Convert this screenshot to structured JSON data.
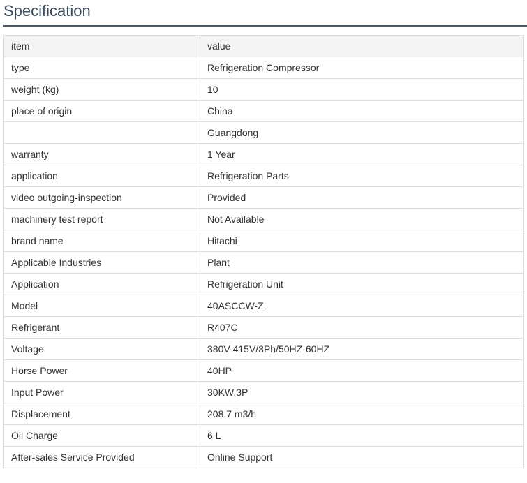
{
  "title": "Specification",
  "table": {
    "header": {
      "item": "item",
      "value": "value"
    },
    "rows": [
      {
        "item": "type",
        "value": "Refrigeration Compressor"
      },
      {
        "item": "weight (kg)",
        "value": "10"
      },
      {
        "item": "place of origin",
        "value": "China"
      },
      {
        "item": "",
        "value": "Guangdong"
      },
      {
        "item": "warranty",
        "value": "1 Year"
      },
      {
        "item": "application",
        "value": "Refrigeration Parts"
      },
      {
        "item": "video outgoing-inspection",
        "value": "Provided"
      },
      {
        "item": "machinery test report",
        "value": "Not Available"
      },
      {
        "item": "brand name",
        "value": "Hitachi"
      },
      {
        "item": "Applicable Industries",
        "value": "Plant"
      },
      {
        "item": "Application",
        "value": "Refrigeration Unit"
      },
      {
        "item": "Model",
        "value": "40ASCCW-Z"
      },
      {
        "item": "Refrigerant",
        "value": "R407C"
      },
      {
        "item": "Voltage",
        "value": "380V-415V/3Ph/50HZ-60HZ"
      },
      {
        "item": "Horse Power",
        "value": "40HP"
      },
      {
        "item": "Input Power",
        "value": "30KW,3P"
      },
      {
        "item": "Displacement",
        "value": "208.7 m3/h"
      },
      {
        "item": "Oil Charge",
        "value": "6 L"
      },
      {
        "item": "After-sales Service Provided",
        "value": "Online Support"
      }
    ]
  },
  "colors": {
    "title_text": "#3c4d5e",
    "title_rule": "#4a5866",
    "header_bg": "#f3f3f3",
    "border": "#dcdcdc",
    "text": "#333333"
  }
}
